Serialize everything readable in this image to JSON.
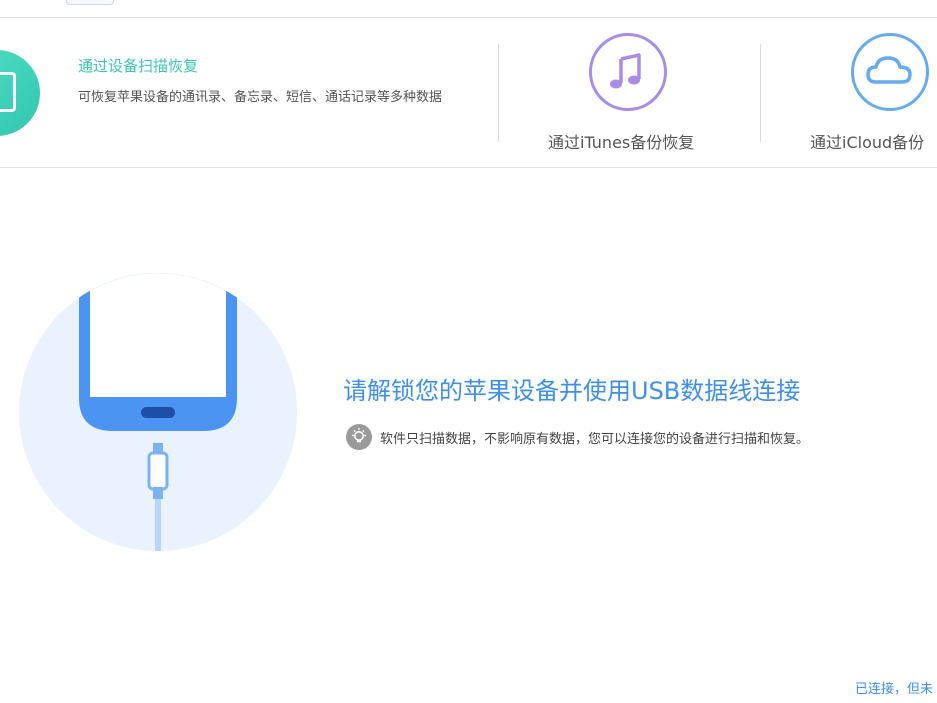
{
  "options": {
    "device_scan": {
      "title": "通过设备扫描恢复",
      "description": "可恢复苹果设备的通讯录、备忘录、短信、通话记录等多种数据",
      "icon": "phone-icon",
      "color": "#3cc6b1"
    },
    "itunes": {
      "label": "通过iTunes备份恢复",
      "icon": "music-note-icon",
      "color": "#a98be8"
    },
    "icloud": {
      "label": "通过iCloud备份",
      "icon": "cloud-icon",
      "color": "#66aaf0"
    }
  },
  "connect_prompt": {
    "message": "请解锁您的苹果设备并使用USB数据线连接",
    "tip_icon": "lightbulb-icon",
    "tip": "软件只扫描数据，不影响原有数据，您可以连接您的设备进行扫描和恢复。",
    "illustration": "phone-usb-cable-illustration",
    "accent_color": "#3e8ff0"
  },
  "status": {
    "text": "已连接，但未"
  }
}
